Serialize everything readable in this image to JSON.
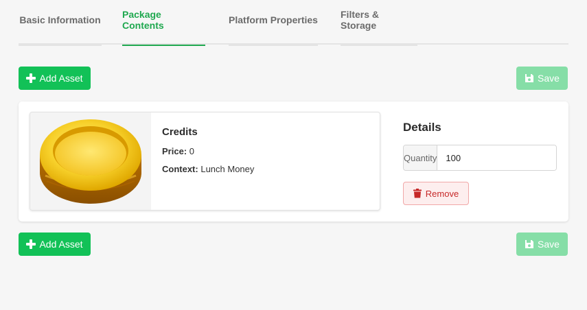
{
  "tabs": [
    {
      "label": "Basic Information",
      "active": false
    },
    {
      "label": "Package Contents",
      "active": true
    },
    {
      "label": "Platform Properties",
      "active": false
    },
    {
      "label": "Filters & Storage",
      "active": false
    }
  ],
  "toolbar": {
    "add_asset_label": "Add Asset",
    "save_label": "Save"
  },
  "asset": {
    "title": "Credits",
    "price_label": "Price:",
    "price_value": "0",
    "context_label": "Context:",
    "context_value": "Lunch Money",
    "image_icon": "gold-coin-icon"
  },
  "details": {
    "title": "Details",
    "quantity_label": "Quantity",
    "quantity_value": "100",
    "remove_label": "Remove"
  },
  "colors": {
    "accent_green": "#1fa84f",
    "add_button": "#12c157",
    "save_button_disabled": "#86dea7",
    "remove_text": "#c62828",
    "remove_bg": "#fdeeee",
    "coin_gold": "#f4c400"
  }
}
